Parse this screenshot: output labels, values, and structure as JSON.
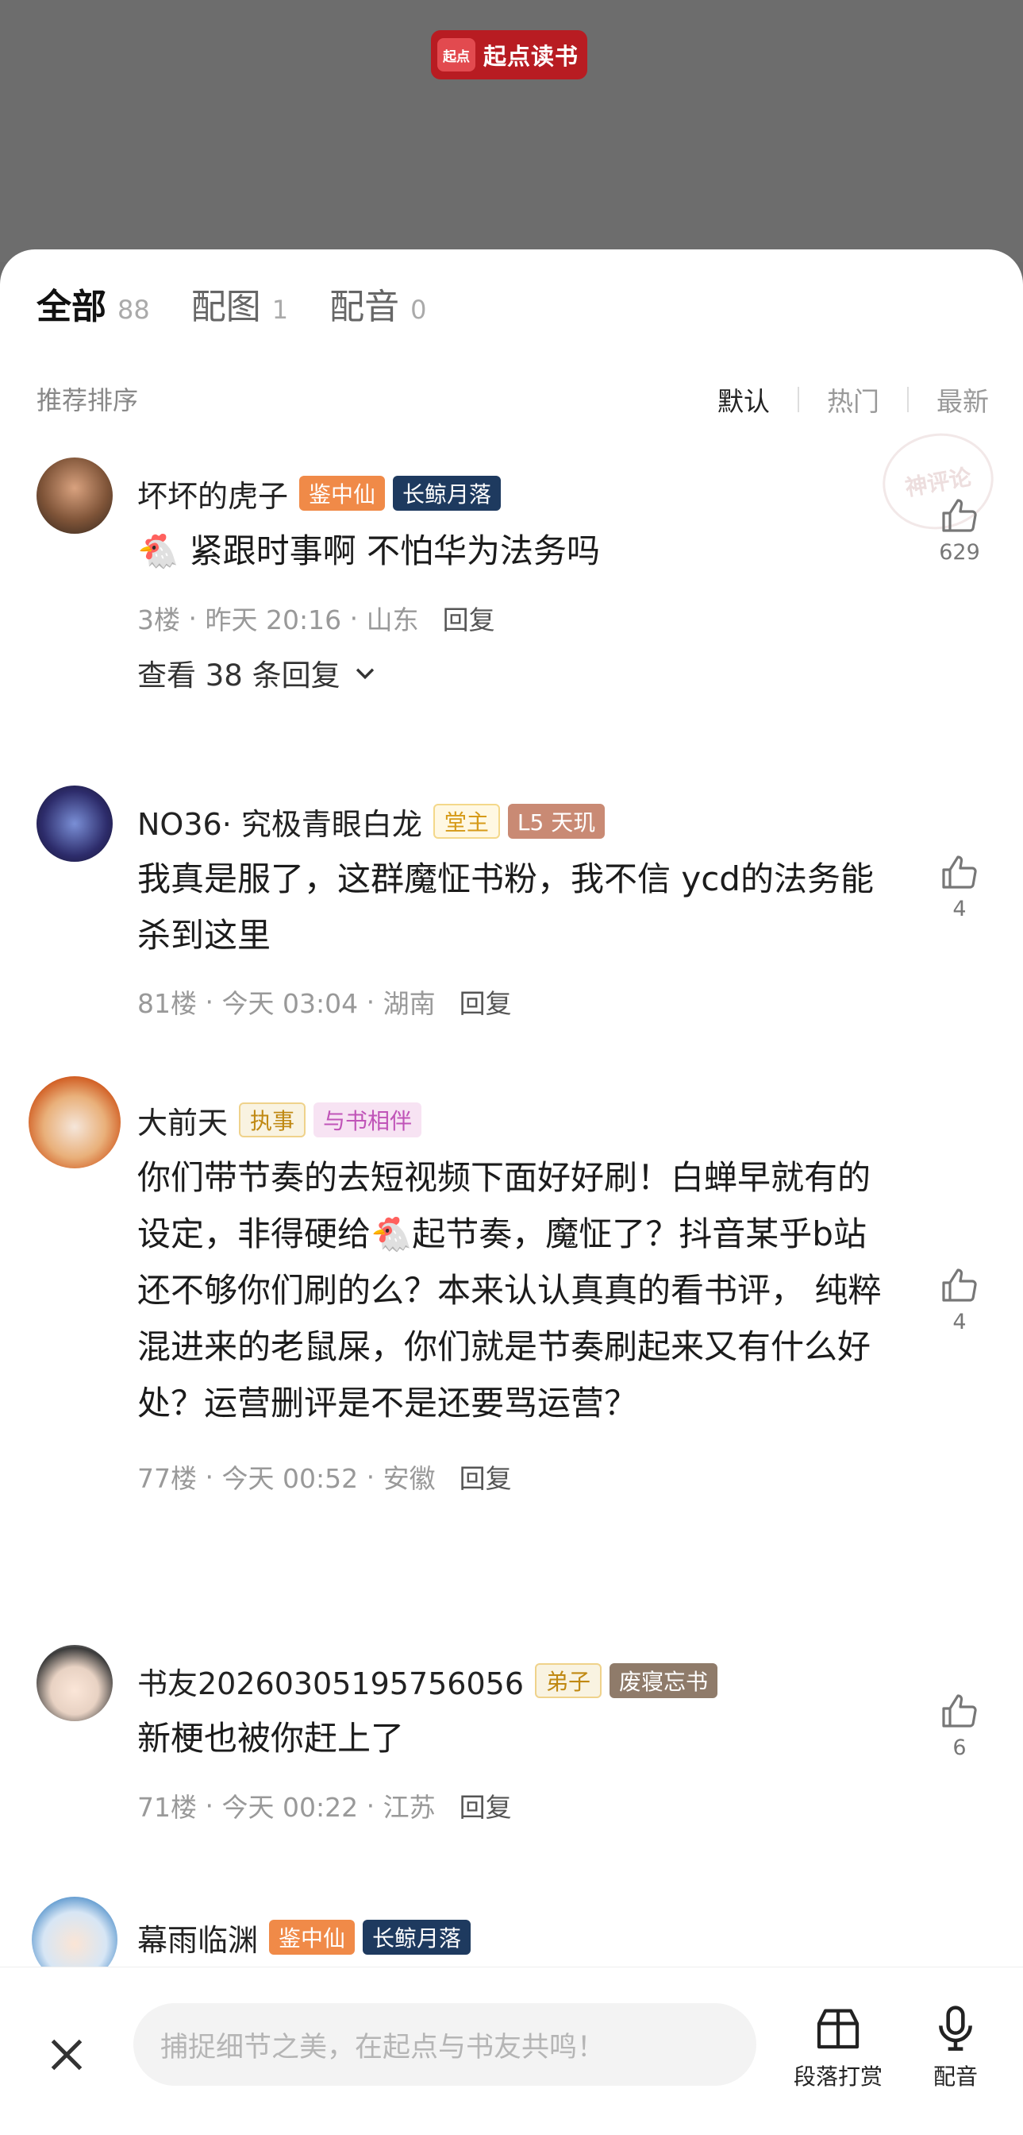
{
  "brand": {
    "logo": "起点",
    "name": "起点读书"
  },
  "tabs": [
    {
      "label": "全部",
      "count": "88"
    },
    {
      "label": "配图",
      "count": "1"
    },
    {
      "label": "配音",
      "count": "0"
    }
  ],
  "sort": {
    "label": "推荐排序",
    "options": [
      "默认",
      "热门",
      "最新"
    ]
  },
  "stamp": "神评论",
  "comments": [
    {
      "user": "坏坏的虎子",
      "badges": [
        "鉴中仙",
        "长鲸月落"
      ],
      "text": "🐔 紧跟时事啊 不怕华为法务吗",
      "floor": "3楼",
      "time": "昨天 20:16",
      "region": "山东",
      "reply": "回复",
      "more": "查看 38 条回复",
      "likes": "629"
    },
    {
      "user": "NO36· 究极青眼白龙",
      "badges": [
        "堂主",
        "L5 天玑"
      ],
      "text": "我真是服了，这群魔怔书粉，我不信 ycd的法务能杀到这里",
      "floor": "81楼",
      "time": "今天 03:04",
      "region": "湖南",
      "reply": "回复",
      "likes": "4"
    },
    {
      "user": "大前天",
      "badges": [
        "执事",
        "与书相伴"
      ],
      "text": "你们带节奏的去短视频下面好好刷！白蝉早就有的设定，非得硬给🐔起节奏，魔怔了？抖音某乎b站还不够你们刷的么？本来认认真真的看书评，  纯粹混进来的老鼠屎，你们就是节奏刷起来又有什么好处？运营删评是不是还要骂运营？",
      "floor": "77楼",
      "time": "今天 00:52",
      "region": "安徽",
      "reply": "回复",
      "likes": "4"
    },
    {
      "user": "书友20260305195756056",
      "badges": [
        "弟子",
        "废寝忘书"
      ],
      "text": "新梗也被你赶上了",
      "floor": "71楼",
      "time": "今天 00:22",
      "region": "江苏",
      "reply": "回复",
      "likes": "6"
    },
    {
      "user": "幕雨临渊",
      "badges": [
        "鉴中仙",
        "长鲸月落"
      ]
    }
  ],
  "input_placeholder": "捕捉细节之美，在起点与书友共鸣！",
  "tools": {
    "reward": "段落打赏",
    "dub": "配音"
  },
  "colors": {
    "accent": "#e2282f",
    "badge_orange": "#f08a48",
    "badge_navy": "#1e3a5f"
  }
}
